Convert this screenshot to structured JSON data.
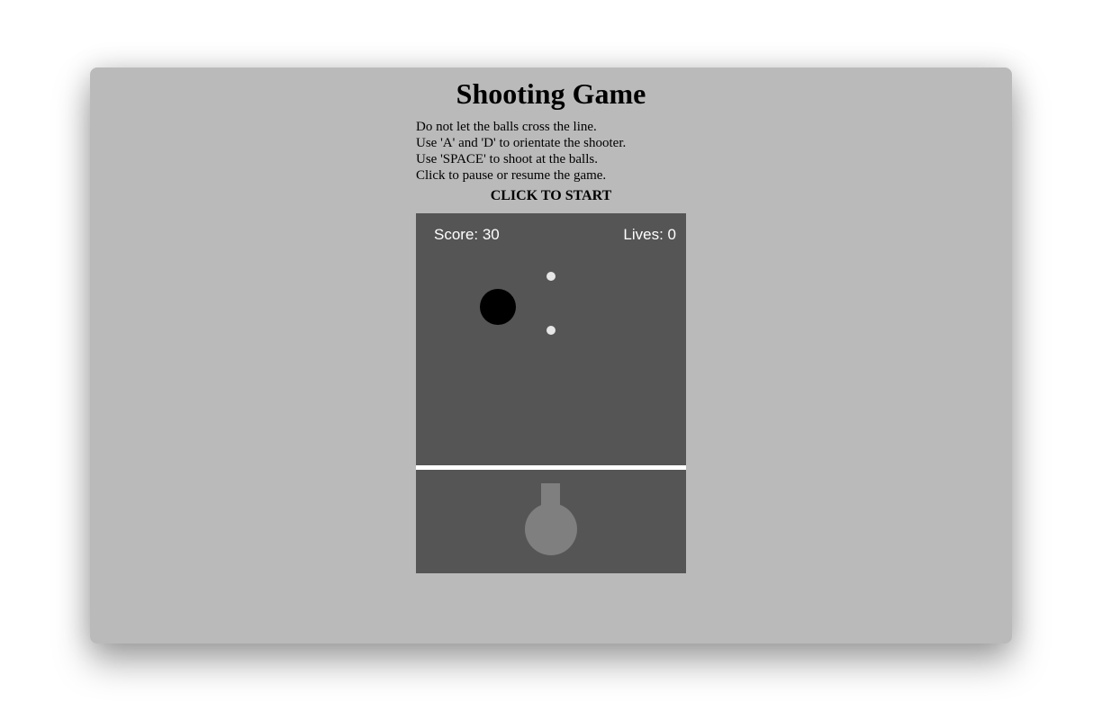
{
  "game": {
    "title": "Shooting Game",
    "instructions": [
      "Do not let the balls cross the line.",
      "Use 'A' and 'D' to orientate the shooter.",
      "Use 'SPACE' to shoot at the balls.",
      "Click to pause or resume the game."
    ],
    "start_label": "CLICK TO START",
    "hud": {
      "score_text": "Score: 30",
      "lives_text": "Lives: 0"
    }
  },
  "colors": {
    "page_background": "#bababa",
    "canvas_background": "#555555",
    "hud_text": "#ffffff",
    "enemy_ball": "#000000",
    "bullet": "#e6e6e6",
    "boundary_line": "#ffffff",
    "shooter": "#7f7f7f"
  }
}
